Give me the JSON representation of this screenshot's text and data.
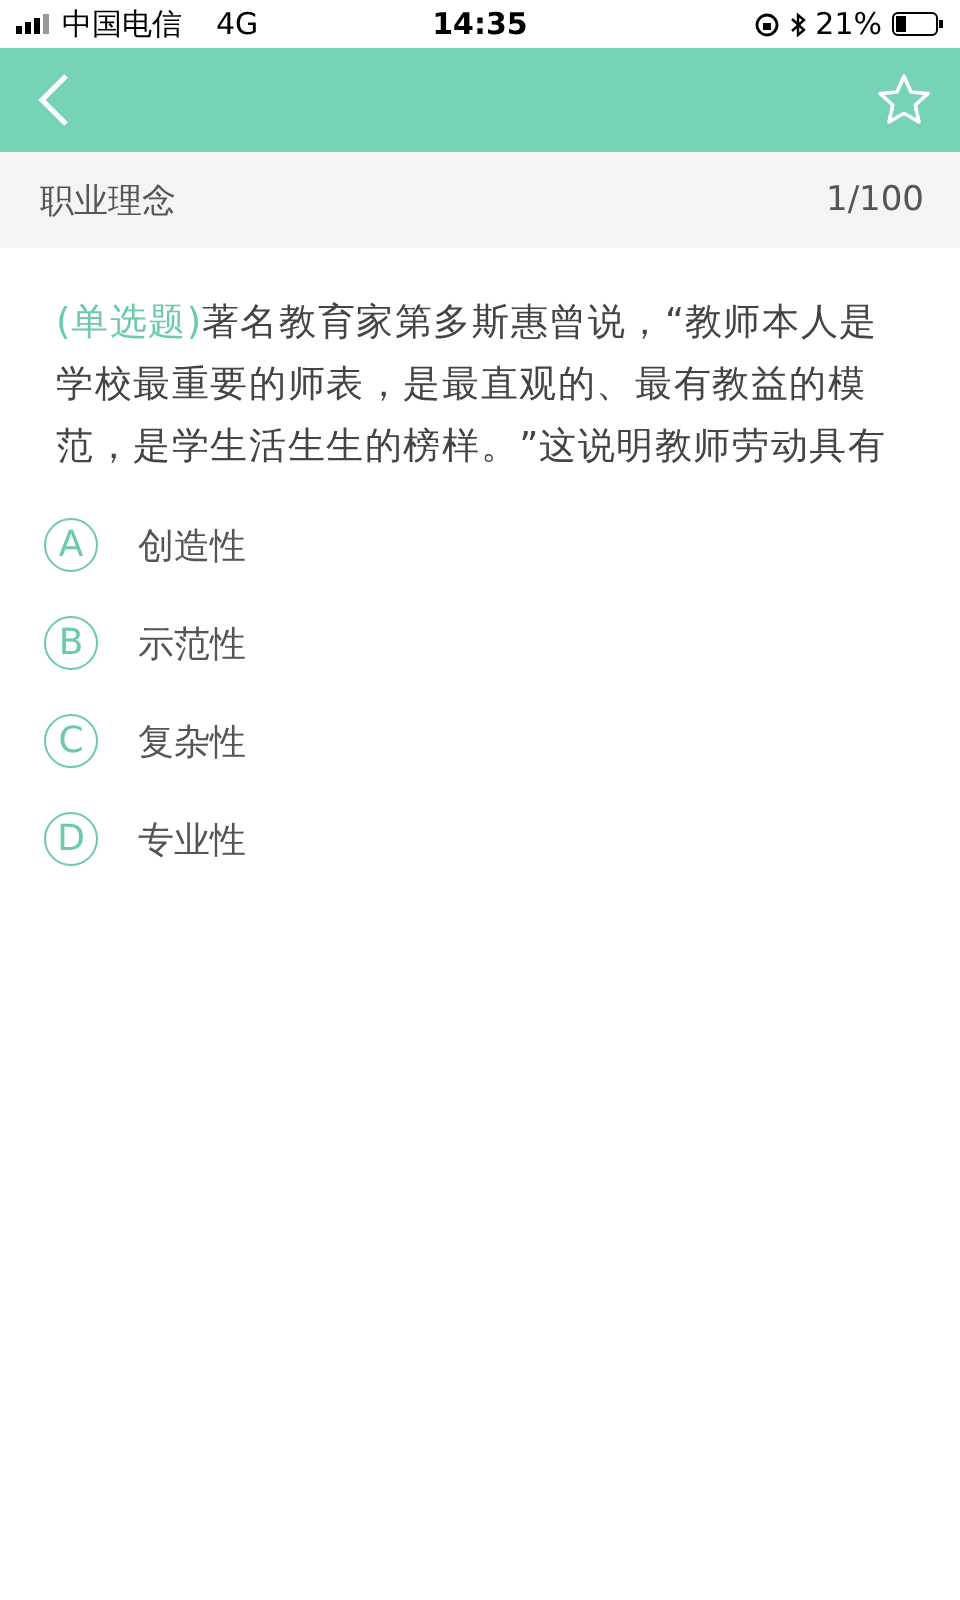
{
  "status_bar": {
    "carrier": "中国电信",
    "network": "4G",
    "time": "14:35",
    "battery": "21%"
  },
  "header": {
    "starred": false
  },
  "subheader": {
    "category": "职业理念",
    "progress": "1/100"
  },
  "question": {
    "type_label": "(单选题)",
    "text": "著名教育家第多斯惠曾说，“教师本人是学校最重要的师表，是最直观的、最有教益的模范，是学生活生生的榜样。”这说明教师劳动具有"
  },
  "options": [
    {
      "letter": "A",
      "text": "创造性",
      "selected": false
    },
    {
      "letter": "B",
      "text": "示范性",
      "selected": false
    },
    {
      "letter": "C",
      "text": "复杂性",
      "selected": false
    },
    {
      "letter": "D",
      "text": "专业性",
      "selected": false
    }
  ]
}
